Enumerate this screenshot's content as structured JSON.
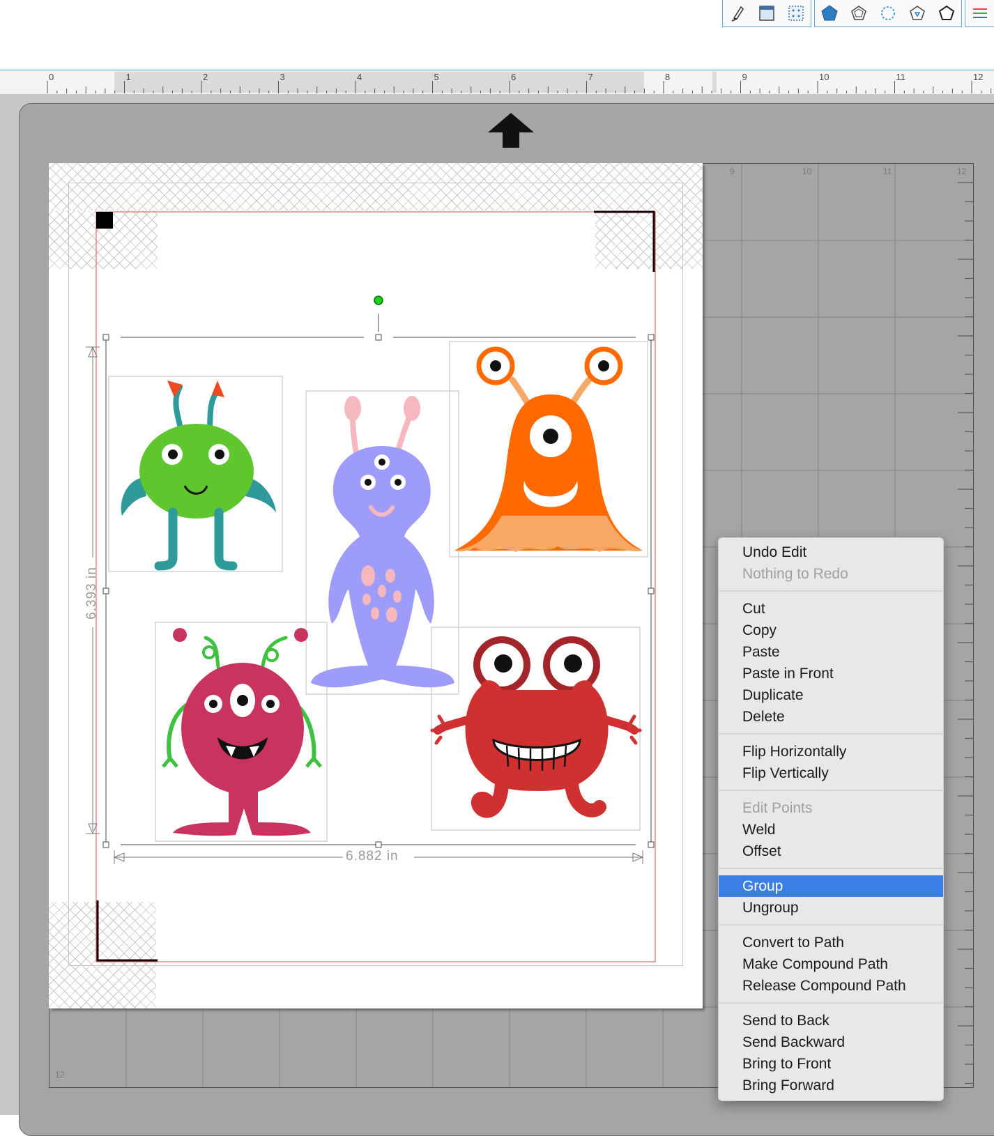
{
  "toolbar": {
    "group1_icons": [
      "knife-icon",
      "panel-icon",
      "pattern-icon"
    ],
    "group2_icons": [
      "pentagon-fill-icon",
      "pentagon-sketch-icon",
      "star-dashed-icon",
      "polygon-offset-icon",
      "polygon-outline-icon"
    ],
    "group3_icons": [
      "lines-menu-icon"
    ]
  },
  "ruler": {
    "labels": [
      "0",
      "1",
      "2",
      "3",
      "4",
      "5",
      "6",
      "7",
      "8",
      "9",
      "10",
      "11",
      "12"
    ]
  },
  "mat": {
    "grid_labels": [
      "9",
      "10",
      "11",
      "12"
    ],
    "bottom_label": "12"
  },
  "selection": {
    "width_label": "6.882 in",
    "height_label": "6.393 in"
  },
  "monsters": [
    "green-monster",
    "purple-monster",
    "orange-monster",
    "magenta-monster",
    "red-monster"
  ],
  "colors": {
    "selection_highlight": "#3b7fe6",
    "cut_border": "#e06a6a",
    "rotate_handle": "#17d417",
    "mat": "#a5a5a5"
  },
  "context_menu": {
    "undo": "Undo Edit",
    "redo": "Nothing to Redo",
    "cut": "Cut",
    "copy": "Copy",
    "paste": "Paste",
    "paste_in_front": "Paste in Front",
    "duplicate": "Duplicate",
    "delete": "Delete",
    "flip_h": "Flip Horizontally",
    "flip_v": "Flip Vertically",
    "edit_points": "Edit Points",
    "weld": "Weld",
    "offset": "Offset",
    "group": "Group",
    "ungroup": "Ungroup",
    "convert_to_path": "Convert to Path",
    "make_compound": "Make Compound Path",
    "release_compound": "Release Compound Path",
    "send_to_back": "Send to Back",
    "send_backward": "Send Backward",
    "bring_to_front": "Bring to Front",
    "bring_forward": "Bring Forward"
  }
}
